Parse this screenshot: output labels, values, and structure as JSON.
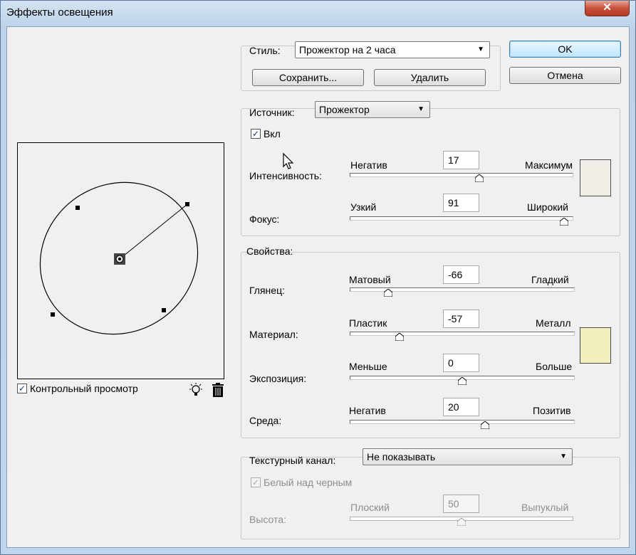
{
  "window": {
    "title": "Эффекты освещения",
    "close_glyph": "✕"
  },
  "preview": {
    "checkbox_label": "Контрольный просмотр",
    "checked": true,
    "light_icon": "light-bulb-icon",
    "trash_icon": "trash-icon"
  },
  "style": {
    "label": "Стиль:",
    "value": "Прожектор на 2 часа",
    "save_label": "Сохранить...",
    "delete_label": "Удалить"
  },
  "dialog_buttons": {
    "ok": "OK",
    "cancel": "Отмена"
  },
  "source": {
    "label": "Источник:",
    "type_value": "Прожектор",
    "on_label": "Вкл",
    "on_checked": true,
    "color": "#f0eee6",
    "sliders": [
      {
        "name": "intensity",
        "label": "Интенсивность:",
        "min_label": "Негатив",
        "max_label": "Максимум",
        "value": "17",
        "position": 0.58
      },
      {
        "name": "focus",
        "label": "Фокус:",
        "min_label": "Узкий",
        "max_label": "Широкий",
        "value": "91",
        "position": 0.96
      }
    ]
  },
  "properties": {
    "label": "Свойства:",
    "color": "#f2efbe",
    "sliders": [
      {
        "name": "gloss",
        "label": "Глянец:",
        "min_label": "Матовый",
        "max_label": "Гладкий",
        "value": "-66",
        "position": 0.17
      },
      {
        "name": "material",
        "label": "Материал:",
        "min_label": "Пластик",
        "max_label": "Металл",
        "value": "-57",
        "position": 0.22
      },
      {
        "name": "exposure",
        "label": "Экспозиция:",
        "min_label": "Меньше",
        "max_label": "Больше",
        "value": "0",
        "position": 0.5
      },
      {
        "name": "ambience",
        "label": "Среда:",
        "min_label": "Негатив",
        "max_label": "Позитив",
        "value": "20",
        "position": 0.6
      }
    ]
  },
  "texture": {
    "label": "Текстурный канал:",
    "channel_value": "Не показывать",
    "white_high_label": "Белый над черным",
    "white_high_checked": true,
    "height": {
      "label": "Высота:",
      "min_label": "Плоский",
      "max_label": "Выпуклый",
      "value": "50",
      "position": 0.5
    }
  }
}
